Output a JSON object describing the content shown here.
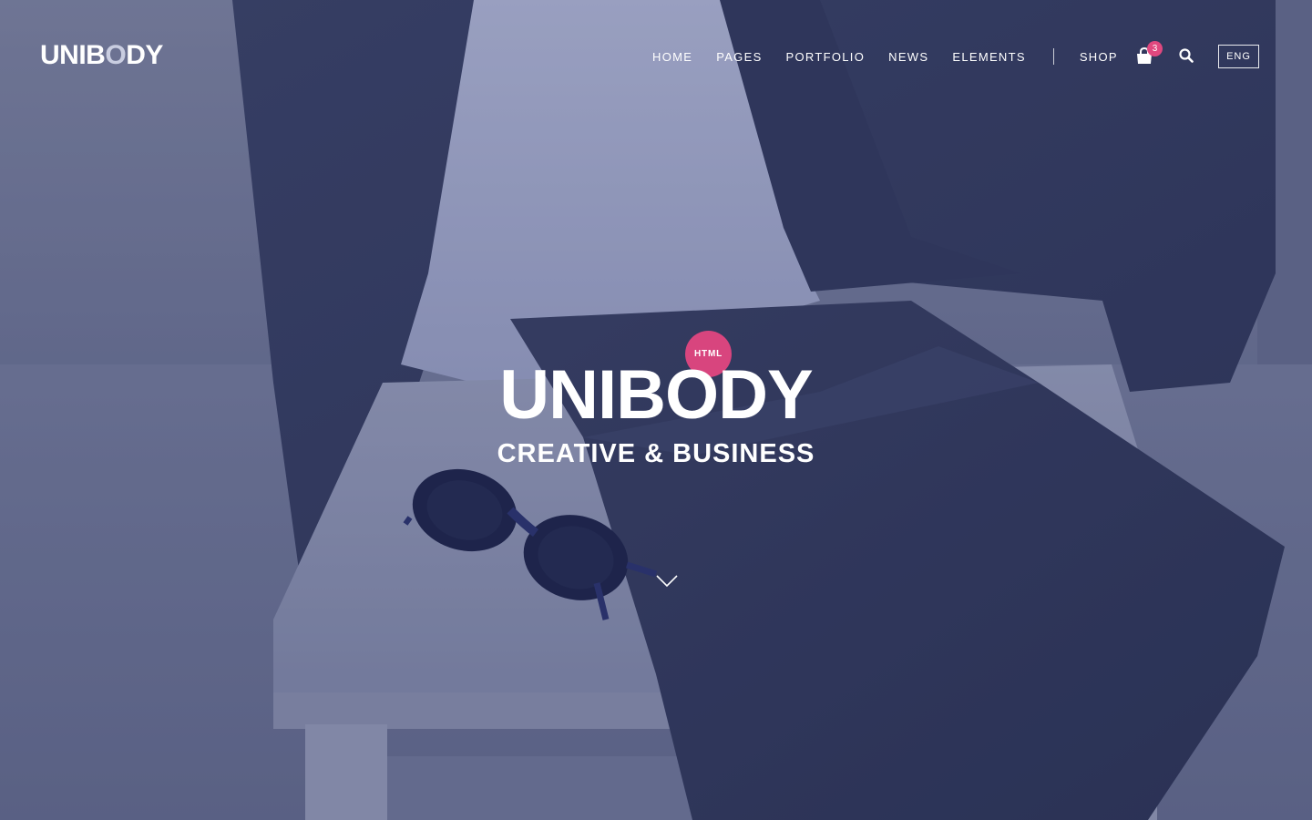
{
  "header": {
    "logo": {
      "text_main": "UNIB",
      "text_o": "O",
      "text_end": "DY"
    },
    "nav": [
      {
        "label": "HOME"
      },
      {
        "label": "PAGES"
      },
      {
        "label": "PORTFOLIO"
      },
      {
        "label": "NEWS"
      },
      {
        "label": "ELEMENTS"
      }
    ],
    "shop_label": "SHOP",
    "cart": {
      "icon": "shopping-bag-icon",
      "count": "3"
    },
    "search_icon": "search-icon",
    "language": "ENG"
  },
  "hero": {
    "badge": "HTML",
    "title": "UNIBODY",
    "subtitle": "CREATIVE & BUSINESS",
    "scroll_icon": "chevron-down-icon"
  },
  "colors": {
    "accent": "#e0487f",
    "overlay": "#3a4470",
    "text": "#ffffff"
  }
}
